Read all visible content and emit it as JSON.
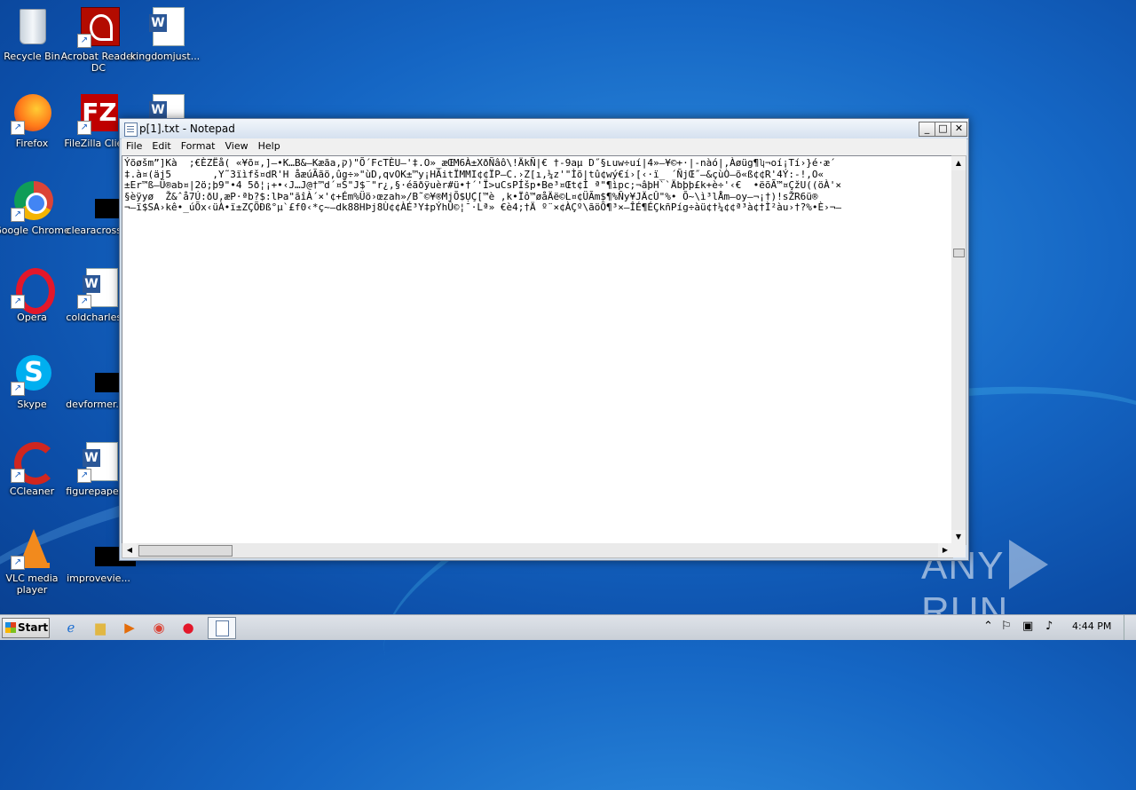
{
  "desktop": {
    "icons": [
      {
        "label": "Recycle Bin",
        "icon": "recycle-bin-icon"
      },
      {
        "label": "Acrobat Reader DC",
        "icon": "acrobat-icon"
      },
      {
        "label": "kingdomjust...",
        "icon": "word-doc-icon"
      },
      {
        "label": "Firefox",
        "icon": "firefox-icon"
      },
      {
        "label": "FileZilla Client",
        "icon": "filezilla-icon"
      },
      {
        "label": "Google Chrome",
        "icon": "chrome-icon"
      },
      {
        "label": "clearacross...",
        "icon": "file-icon"
      },
      {
        "label": "Opera",
        "icon": "opera-icon"
      },
      {
        "label": "coldcharles...",
        "icon": "word-doc-icon"
      },
      {
        "label": "Skype",
        "icon": "skype-icon"
      },
      {
        "label": "devformer.r...",
        "icon": "file-icon"
      },
      {
        "label": "CCleaner",
        "icon": "ccleaner-icon"
      },
      {
        "label": "figurepaper...",
        "icon": "word-doc-icon"
      },
      {
        "label": "VLC media player",
        "icon": "vlc-icon"
      },
      {
        "label": "improvevie...",
        "icon": "file-icon"
      }
    ]
  },
  "notepad": {
    "title": "p[1].txt - Notepad",
    "menu": [
      "File",
      "Edit",
      "Format",
      "View",
      "Help"
    ],
    "content": "Ýõøšm”]Kà  ;€ÈZËå( «¥õ¤‚]—•K…B&—Kæãa,ק)\"Õ´FcTÈU–'‡.O»_æŒM6À±XðÑâô\\!ÄkÑ|€ †-9aµ D˝§ʟuw÷uí|4»–¥©+·|-nàó|,Àøüg¶ʮ¬oí¡Tí›}é·æ´\n‡.à¤(äj5       ,Y˜3ïìfš¤dR'H åæúÃãö,ûg÷»\"ùD,qvOK±™y¡HÃitÏMMI¢¢ÏP—C.›Z[ı,¼z'\"Ìõ|tû¢wý€í›[‹·ï_ ´ÑjŒ˝–&çùÒ—õ«ß¢¢R'4Ý:-!,O«\n±Er™ß—Ü®ab¤|2ö;þ9\"•4 5ð¦¡+•‹J…J@†™d´¤Š\"J$¨\"r¿‚§·éãðÿuèr#ü•†´'Ï>uCsPÍšp•Be³¤Œt¢Ì ª\"¶ìpc;¬âþH``Äbþþ£k+è÷'‹€  •ëõÃ™¤ÇžU((öÀ'×\n§ѐÿyø  Ž&ˆå7Ú:ðU,æP·ªb?$:lÞa\"ãîÀ´×'¢+Ém%Üö›œzah»/B˜©¥®MjÕ$Ụ́Ç[™è ,k•Ïô™øåÄë©L¤¢ÜÃm$¶%Ñy¥JÄcÛ\"%• Õ~\\ì³lÅm—oy—¬¡†)!sŽR6ü®\n¬—ï$SA›kê•_úÕx‹üÀ•ï±ZÇÕÐß°µ`£f0‹*ç~—dk88HÞj8Ù¢¢ÀÉ³Y‡pÝhÛ©¦¯·Lª» €è4;†Ä º¨×¢ÀÇº\\ãöÕ¶³×—ÎÉ¶ÉÇkñPíg÷àü¢†¼¢¢ª³à¢†Ì²àu›†?%•È›¬–"
  },
  "watermark": {
    "text_left": "ANY",
    "text_right": "RUN"
  },
  "taskbar": {
    "start_label": "Start",
    "clock": "4:44 PM"
  }
}
